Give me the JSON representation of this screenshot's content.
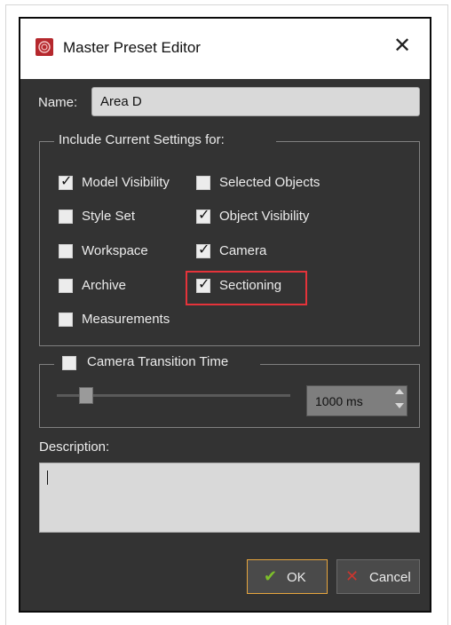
{
  "dialog": {
    "title": "Master Preset Editor",
    "close_glyph": "✕",
    "app_icon": "app-logo-icon"
  },
  "name": {
    "label": "Name:",
    "value": "Area D"
  },
  "include_group": {
    "legend": "Include Current Settings for:",
    "options": [
      {
        "label": "Model Visibility",
        "checked": true
      },
      {
        "label": "Selected Objects",
        "checked": false
      },
      {
        "label": "Style Set",
        "checked": false
      },
      {
        "label": "Object Visibility",
        "checked": true
      },
      {
        "label": "Workspace",
        "checked": false
      },
      {
        "label": "Camera",
        "checked": true
      },
      {
        "label": "Archive",
        "checked": false
      },
      {
        "label": "Sectioning",
        "checked": true
      },
      {
        "label": "Measurements",
        "checked": false
      }
    ]
  },
  "camera_group": {
    "legend": "Camera Transition Time",
    "enabled": false,
    "value_text": "1000 ms"
  },
  "description": {
    "label": "Description:",
    "value": ""
  },
  "buttons": {
    "ok_label": "OK",
    "ok_glyph": "✔",
    "cancel_label": "Cancel",
    "cancel_glyph": "✕"
  },
  "colors": {
    "dialog_bg": "#333333",
    "highlight": "#e5333a",
    "ok_border": "#e6a53e",
    "ok_check": "#7dbf2a",
    "cancel_x": "#c9362f"
  }
}
